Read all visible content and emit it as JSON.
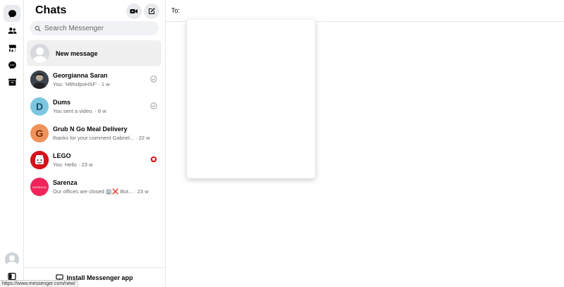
{
  "rail": {
    "items": [
      {
        "name": "chats",
        "icon": "chat-bubble-icon",
        "active": true
      },
      {
        "name": "people",
        "icon": "people-icon"
      },
      {
        "name": "marketplace",
        "icon": "store-icon"
      },
      {
        "name": "requests",
        "icon": "message-dots-icon"
      },
      {
        "name": "archive",
        "icon": "archive-icon"
      }
    ]
  },
  "panel": {
    "title": "Chats",
    "search_placeholder": "Search Messenger",
    "new_message_label": "New message",
    "install_label": "Install Messenger app"
  },
  "conversations": [
    {
      "name": "Georgianna Saran",
      "preview": "You: 'HfihsfpoHSF' · 1 w",
      "avatar_color": "#5b6470",
      "initial": "",
      "status": "sent"
    },
    {
      "name": "Dums",
      "preview": "You sent a video. · 8 w",
      "avatar_color": "#7cc7e0",
      "initial": "D",
      "status": "sent"
    },
    {
      "name": "Grub N Go Meal Delivery",
      "preview": "thanks for your comment Gabriel... · 22 w",
      "avatar_color": "#f0935a",
      "initial": "G",
      "status": "none"
    },
    {
      "name": "LEGO",
      "preview": "You: Hello · 23 w",
      "avatar_color": "#d6121b",
      "initial": "",
      "status": "seen"
    },
    {
      "name": "Sarenza",
      "preview": "Our offices are closed 🏢❌ But... · 23 w",
      "avatar_color": "#f0245a",
      "initial": "SARENZA",
      "status": "none"
    }
  ],
  "main": {
    "to_label": "To:"
  },
  "statusbar": {
    "url": "https://www.messenger.com/new/"
  }
}
